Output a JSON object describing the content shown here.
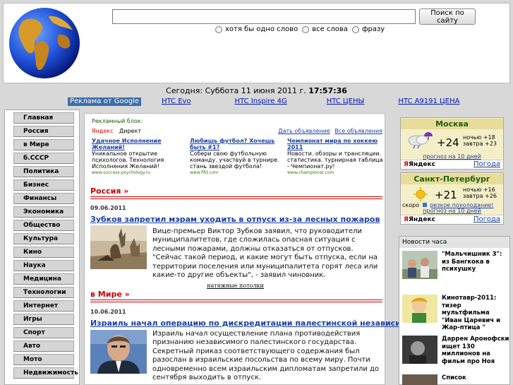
{
  "search": {
    "placeholder": "",
    "button_label": "Поиск по сайту",
    "modes": [
      "хотя бы одно слово",
      "все слова",
      "фразу"
    ]
  },
  "dateline": {
    "prefix": "Сегодня: Суббота 11 июня 2011 г.",
    "time": "17:57:36"
  },
  "ads": {
    "label": "Реклама от Google",
    "links": [
      "HTC Evo",
      "HTC Inspire 4G",
      "HTC ЦЕНЫ",
      "HTC A9191 ЦЕНА"
    ]
  },
  "nav": [
    "Главная",
    "Россия",
    "в Мире",
    "б.СССР",
    "Политика",
    "Бизнес",
    "Финансы",
    "Экономика",
    "Общество",
    "Культура",
    "Кино",
    "Наука",
    "Медицина",
    "Технологии",
    "Интернет",
    "Игры",
    "Спорт",
    "Авто",
    "Мото",
    "Недвижимость"
  ],
  "yandex_direct": {
    "block_label": "Рекламный блок:",
    "brand": "Яндекс",
    "direct": "Директ",
    "give_ad": "Дать объявление",
    "all_ads": "Все объявления",
    "items": [
      {
        "title": "Удачное Исполнение Желаний!",
        "desc": "Уникальное открытие психологов. Технология Исполнения Желаний!",
        "url": "www.success-psychology.ru"
      },
      {
        "title": "Любишь футбол? Хочешь быть #1?",
        "desc": "Собери свою футбольную команду. участвуй в турнире. стань звездой футбола!",
        "url": "www.fifd.com"
      },
      {
        "title": "Чемпионат мира по хоккею 2011",
        "desc": "Новости. обзоры и трансляции. статистика. турнирная таблица - Чемпионат.ру!",
        "url": "www.championat.com"
      }
    ]
  },
  "sections": [
    {
      "title": "Россия »",
      "date": "09.06.2011",
      "headline": "Зубков запретил мэрам уходить в отпуск из-за лесных пожаров",
      "lead": "Вице-премьер Виктор Зубков заявил, что руководители муниципалитетов, где сложилась опасная ситуация с лесными пожарами, должны отказаться от отпусков. \"Сейчас такой период, и какие могут быть отпуска, если на территории поселения или муниципалитета горят леса или какие-то другие объекты\", - заявил чиновник."
    },
    {
      "title": "в Мире »",
      "date": "10.06.2011",
      "headline": "Израиль начал операцию по дискредитации палестинской независимости",
      "lead": "Израиль начал осуществление плана противодействия признанию независимого палестинского государства. Секретный приказ соответствующего содержания был разослан в израильские посольства по всему миру. Почти одновременно всем израильским дипломатам запретили до сентября выходить в отпуск."
    }
  ],
  "ceilings_link": "натяжные потолки",
  "weather": [
    {
      "city": "Москва",
      "temp": "+24",
      "night": "ночью +18",
      "tomorrow": "завтра +23",
      "soon": "",
      "forecast": "прогноз на 10 дней",
      "brand": "Яндекс",
      "weather_link": "Погода"
    },
    {
      "city": "Санкт-Петербург",
      "temp": "+21",
      "night": "ночью +16",
      "tomorrow": "завтра +26",
      "soon": "скоро",
      "soon_text": "резкое похолодание!",
      "forecast": "прогноз на 10 дней",
      "brand": "Яндекс",
      "weather_link": "Погода"
    }
  ],
  "news_hour": {
    "title": "Новости часа",
    "items": [
      "\"Мальчишник 3\": из Бангкока в психушку",
      "Кинотавр-2011: тизер мультфильма \"Иван Царевич и Жар-птица \"",
      "Даррен Аронофски ищет 130 миллионов на фильм про Ноя",
      "Список"
    ]
  },
  "colors": {
    "accent_red": "#cc0000",
    "link_blue": "#1a3fa8",
    "ad_label_bg": "#3d6ea8",
    "weather_bg": "#f5efc9"
  }
}
